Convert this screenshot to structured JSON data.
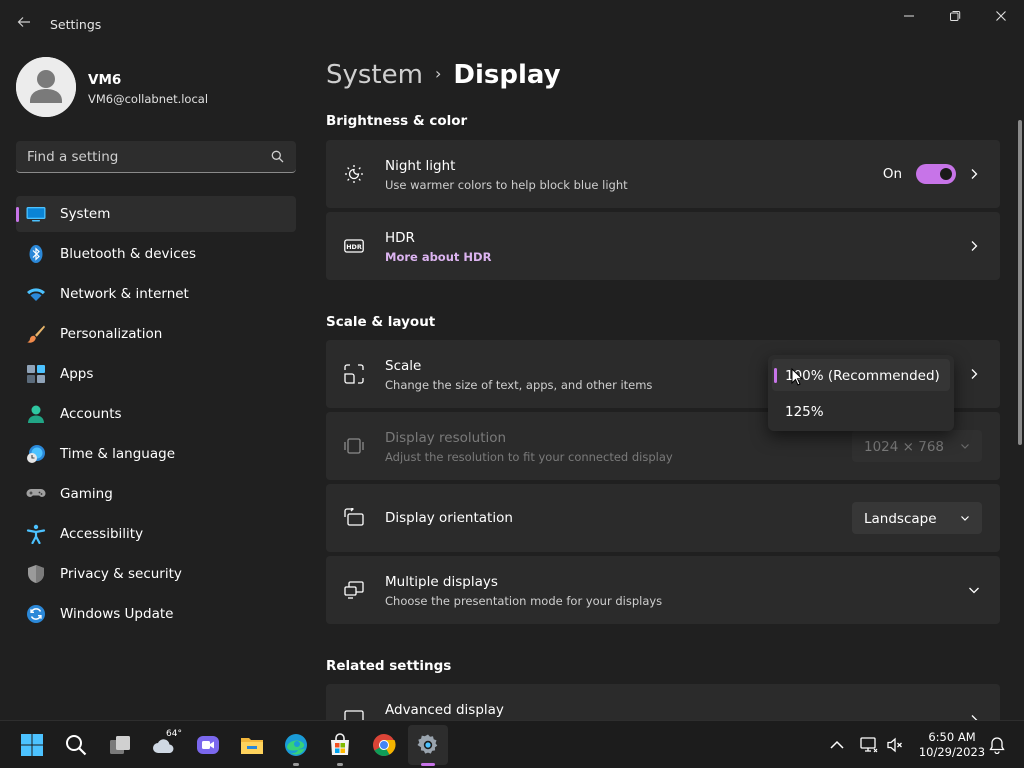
{
  "window": {
    "title": "Settings"
  },
  "profile": {
    "name": "VM6",
    "email": "VM6@collabnet.local"
  },
  "search": {
    "placeholder": "Find a setting"
  },
  "sidebar": {
    "items": [
      {
        "label": "System",
        "icon": "system-monitor-icon",
        "active": true
      },
      {
        "label": "Bluetooth & devices",
        "icon": "bluetooth-icon"
      },
      {
        "label": "Network & internet",
        "icon": "wifi-icon"
      },
      {
        "label": "Personalization",
        "icon": "brush-icon"
      },
      {
        "label": "Apps",
        "icon": "apps-icon"
      },
      {
        "label": "Accounts",
        "icon": "person-icon"
      },
      {
        "label": "Time & language",
        "icon": "globe-clock-icon"
      },
      {
        "label": "Gaming",
        "icon": "gamepad-icon"
      },
      {
        "label": "Accessibility",
        "icon": "accessibility-icon"
      },
      {
        "label": "Privacy & security",
        "icon": "shield-icon"
      },
      {
        "label": "Windows Update",
        "icon": "update-icon"
      }
    ]
  },
  "breadcrumb": {
    "parent": "System",
    "separator": "›",
    "current": "Display"
  },
  "sections": {
    "brightness": {
      "title": "Brightness & color",
      "night_light": {
        "title": "Night light",
        "subtitle": "Use warmer colors to help block blue light",
        "toggle_label": "On",
        "toggle_on": true
      },
      "hdr": {
        "title": "HDR",
        "link": "More about HDR"
      }
    },
    "scale_layout": {
      "title": "Scale & layout",
      "scale": {
        "title": "Scale",
        "subtitle": "Change the size of text, apps, and other items"
      },
      "resolution": {
        "title": "Display resolution",
        "subtitle": "Adjust the resolution to fit your connected display",
        "value": "1024 × 768"
      },
      "orientation": {
        "title": "Display orientation",
        "value": "Landscape"
      },
      "multiple": {
        "title": "Multiple displays",
        "subtitle": "Choose the presentation mode for your displays"
      }
    },
    "related": {
      "title": "Related settings",
      "advanced": {
        "title": "Advanced display"
      }
    }
  },
  "scale_dropdown": {
    "options": [
      {
        "label": "100% (Recommended)",
        "selected": true
      },
      {
        "label": "125%",
        "selected": false
      }
    ]
  },
  "taskbar": {
    "weather_temp": "64°",
    "clock_time": "6:50 AM",
    "clock_date": "10/29/2023"
  },
  "colors": {
    "accent": "#c774e8",
    "background": "#202020",
    "card": "#2b2b2b"
  }
}
